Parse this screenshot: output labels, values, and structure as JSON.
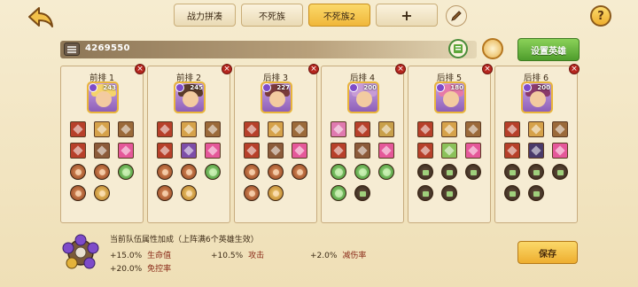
{
  "tabs": [
    {
      "label": "战力拼凑",
      "active": false
    },
    {
      "label": "不死族",
      "active": false
    },
    {
      "label": "不死族2",
      "active": true
    },
    {
      "label": "+",
      "active": false
    }
  ],
  "help_label": "?",
  "power": {
    "value": "4269550"
  },
  "set_hero_label": "设置英雄",
  "columns": [
    {
      "title": "前排 1",
      "level": "243",
      "hair": "#f5d46b",
      "items": [
        "#b7402a",
        "#d6a24a",
        "#9b6a3a",
        "#b7402a",
        "#8c5b3a",
        "#e5589a"
      ],
      "runes": [
        "red",
        "red",
        "green",
        "red",
        "gold"
      ]
    },
    {
      "title": "前排 2",
      "level": "245",
      "hair": "#5b3a2a",
      "items": [
        "#b7402a",
        "#d6a24a",
        "#9b6a3a",
        "#b7402a",
        "#7d4ea8",
        "#e5589a"
      ],
      "runes": [
        "red",
        "red",
        "green",
        "red",
        "gold"
      ]
    },
    {
      "title": "后排 3",
      "level": "227",
      "hair": "#7a3a3a",
      "items": [
        "#b7402a",
        "#d6a24a",
        "#9b6a3a",
        "#b7402a",
        "#8c5b3a",
        "#e5589a"
      ],
      "runes": [
        "red",
        "red",
        "red",
        "red",
        "gold"
      ]
    },
    {
      "title": "后排 4",
      "level": "200",
      "hair": "#c79bd6",
      "items": [
        "#e07ab0",
        "#b7402a",
        "#c9a04a",
        "#b7402a",
        "#8c5b3a",
        "#e5589a"
      ],
      "runes": [
        "green",
        "green",
        "green",
        "green",
        "dark"
      ]
    },
    {
      "title": "后排 5",
      "level": "180",
      "hair": "#e67aa8",
      "items": [
        "#b7402a",
        "#d6a24a",
        "#9b6a3a",
        "#b7402a",
        "#8bc15a",
        "#e5589a"
      ],
      "runes": [
        "dark",
        "dark",
        "dark",
        "dark",
        "dark"
      ]
    },
    {
      "title": "后排 6",
      "level": "200",
      "hair": "#8a3a6a",
      "items": [
        "#b7402a",
        "#d6a24a",
        "#9b6a3a",
        "#b7402a",
        "#4a3a6a",
        "#e5589a"
      ],
      "runes": [
        "dark",
        "dark",
        "dark",
        "dark",
        "dark"
      ]
    }
  ],
  "bonus": {
    "title": "当前队伍属性加成（上阵满6个英雄生效）",
    "stats": [
      {
        "value": "+15.0%",
        "label": "生命值"
      },
      {
        "value": "+10.5%",
        "label": "攻击"
      },
      {
        "value": "+2.0%",
        "label": "减伤率"
      },
      {
        "value": "+20.0%",
        "label": "免控率"
      }
    ]
  },
  "save_label": "保存",
  "colors": {
    "accent": "#f0b73a",
    "green": "#4e9d2c",
    "close": "#b6261e"
  }
}
